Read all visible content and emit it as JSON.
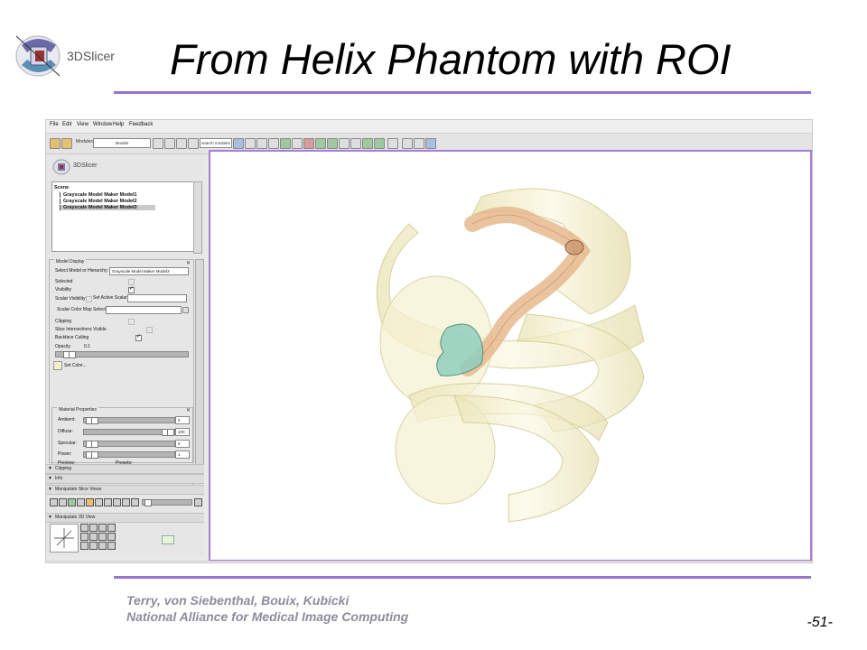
{
  "slide": {
    "title": "From Helix Phantom with ROI",
    "logo_text": "3DSlicer",
    "author": "Terry, von Siebenthal, Bouix, Kubicki",
    "organization": "National Alliance for Medical Image Computing",
    "page_number": "-51-",
    "accent_color": "#9b72cf"
  },
  "app": {
    "menu": [
      "File",
      "Edit",
      "View",
      "Window",
      "Help",
      "Feedback"
    ],
    "toolbar": {
      "modules_label": "Modules:",
      "module_value": "Models",
      "search_placeholder": "search modules"
    },
    "panel_logo_text": "3DSlicer",
    "tree": {
      "root": "Scene",
      "items": [
        "Grayscale Model Maker Model1",
        "Grayscale Model Maker Model2",
        "Grayscale Model Maker Model3"
      ],
      "selected_index": 2
    },
    "model_display": {
      "title": "Model Display",
      "select_label": "Select Model or Hierarchy:",
      "select_value": "Grayscale Model Maker Model3",
      "selected_label": "Selected",
      "selected": false,
      "visibility_label": "Visibility",
      "visibility": true,
      "scalar_visibility_label": "Scalar Visibility",
      "scalar_visibility": false,
      "set_active_scalar_label": "Set Active Scalar:",
      "scalar_color_map_label": "Scalar Color Map Select:",
      "clipping_label": "Clipping",
      "clipping": false,
      "slice_intersections_label": "Slice Intersections Visible",
      "slice_intersections": false,
      "backface_culling_label": "Backface Culling",
      "backface_culling": true,
      "opacity_label": "Opacity",
      "opacity_value": "0.1",
      "set_color_label": "Set Color..."
    },
    "material": {
      "title": "Material Properties",
      "ambient_label": "Ambient:",
      "ambient_value": "0",
      "diffuse_label": "Diffuse:",
      "diffuse_value": "100",
      "specular_label": "Specular:",
      "specular_value": "0",
      "power_label": "Power:",
      "power_value": "1",
      "preview_label": "Preview:",
      "presets_label": "Presets:"
    },
    "collapsers": {
      "clipping": "Clipping",
      "info": "Info",
      "manipulate_slice": "Manipulate Slice Views",
      "manipulate_3d": "Manipulate 3D View"
    },
    "view3d": {
      "frame_color": "#a77cd8",
      "helix_color": "#f3efc9",
      "tract_color": "#e6b98e",
      "roi_color": "#8fcfbd"
    }
  }
}
